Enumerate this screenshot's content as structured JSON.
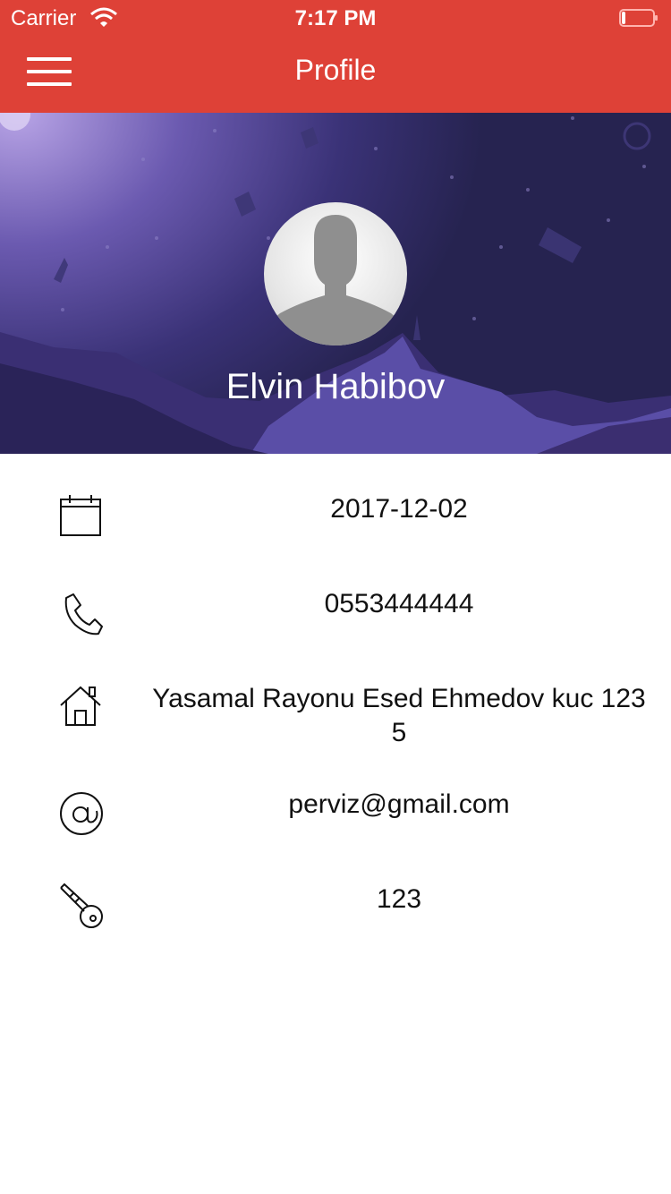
{
  "status_bar": {
    "carrier": "Carrier",
    "time": "7:17 PM"
  },
  "header": {
    "title": "Profile",
    "bar_color": "#de4137"
  },
  "profile": {
    "name": "Elvin Habibov",
    "hero_colors": [
      "#2a2756",
      "#4a3f8a",
      "#6a5cbc"
    ]
  },
  "details": [
    {
      "icon": "calendar-icon",
      "value": "2017-12-02"
    },
    {
      "icon": "phone-icon",
      "value": "0553444444"
    },
    {
      "icon": "home-icon",
      "value": "Yasamal Rayonu Esed Ehmedov kuc 123 5"
    },
    {
      "icon": "at-icon",
      "value": "perviz@gmail.com"
    },
    {
      "icon": "key-icon",
      "value": "123"
    }
  ]
}
